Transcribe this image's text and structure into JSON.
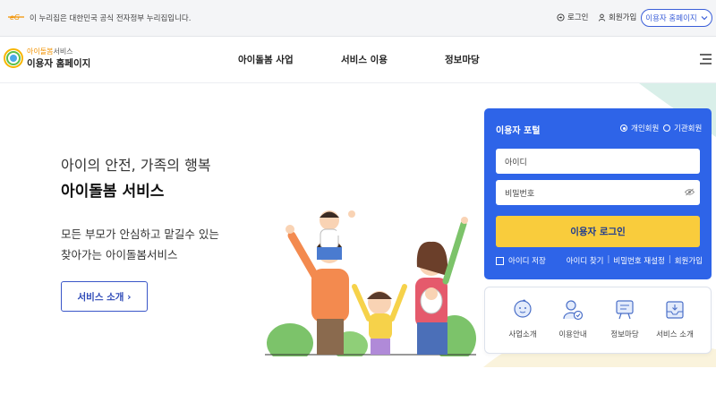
{
  "gov_banner": {
    "text": "이 누리집은 대한민국 공식 전자정부 누리집입니다.",
    "login": "로그인",
    "signup": "회원가입",
    "user_home": "이용자 홈페이지"
  },
  "header": {
    "logo_top_brand": "아이돌봄",
    "logo_top_suffix": "서비스",
    "logo_bottom": "이용자 홈페이지",
    "nav": [
      "아이돌봄 사업",
      "서비스 이용",
      "정보마당"
    ]
  },
  "hero": {
    "subtitle": "아이의 안전, 가족의 행복",
    "title": "아이돌봄 서비스",
    "desc_line1": "모든 부모가 안심하고 맡길수 있는",
    "desc_line2": "찾아가는 아이돌봄서비스",
    "button": "서비스 소개 ›"
  },
  "portal": {
    "title": "이용자 포털",
    "radio_personal": "개인회원",
    "radio_org": "기관회원",
    "selected": "개인회원",
    "id_placeholder": "아이디",
    "pw_placeholder": "비밀번호",
    "login_button": "이용자 로그인",
    "save_id": "아이디 저장",
    "links": [
      "아이디 찾기",
      "비밀번호 재설정",
      "회원가입"
    ]
  },
  "quick_menu": [
    "사업소개",
    "이용안내",
    "정보마당",
    "서비스 소개"
  ],
  "colors": {
    "portal_blue": "#2e64e8",
    "login_yellow": "#f9cc3c",
    "brand_orange": "#f29200",
    "accent_blue": "#3a5ed8"
  },
  "icons": [
    "eg-logo-icon",
    "login-icon",
    "person-icon",
    "chevron-down-icon",
    "menu-icon",
    "eye-off-icon",
    "baby-icon",
    "user-check-icon",
    "board-icon",
    "inbox-icon"
  ]
}
